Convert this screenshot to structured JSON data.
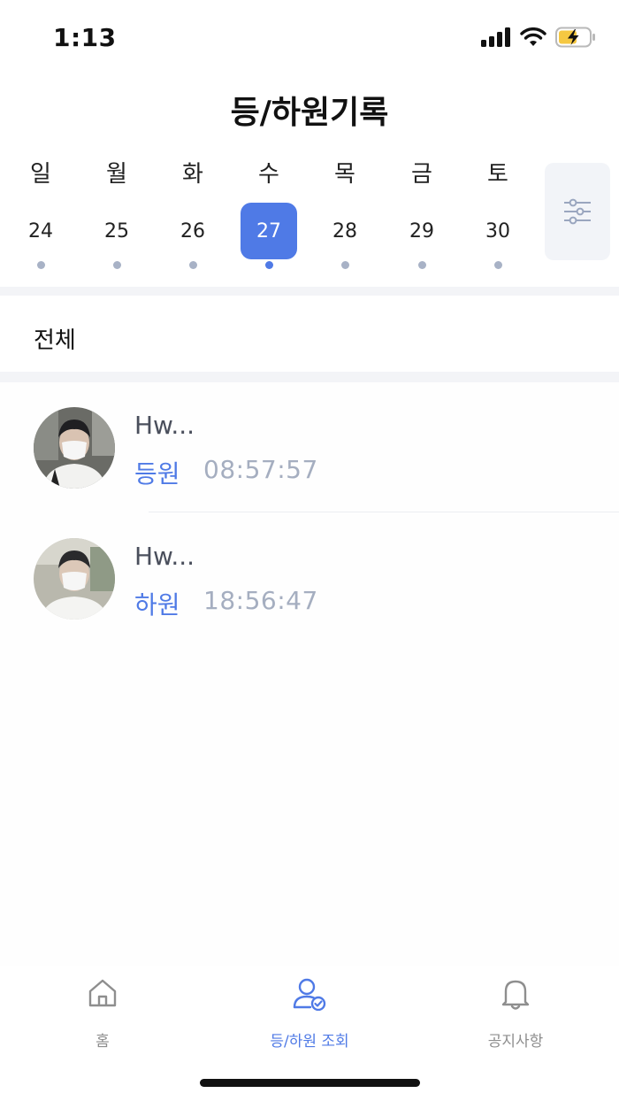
{
  "status_bar": {
    "time": "1:13"
  },
  "header": {
    "title": "등/하원기록"
  },
  "calendar": {
    "days": [
      {
        "weekday": "일",
        "date": "24",
        "selected": false
      },
      {
        "weekday": "월",
        "date": "25",
        "selected": false
      },
      {
        "weekday": "화",
        "date": "26",
        "selected": false
      },
      {
        "weekday": "수",
        "date": "27",
        "selected": true
      },
      {
        "weekday": "목",
        "date": "28",
        "selected": false
      },
      {
        "weekday": "금",
        "date": "29",
        "selected": false
      },
      {
        "weekday": "토",
        "date": "30",
        "selected": false
      }
    ],
    "filter_icon": "sliders-icon"
  },
  "filter": {
    "label": "전체"
  },
  "records": [
    {
      "name": "Hw...",
      "type": "등원",
      "time": "08:57:57"
    },
    {
      "name": "Hw...",
      "type": "하원",
      "time": "18:56:47"
    }
  ],
  "tabbar": {
    "tabs": [
      {
        "label": "홈",
        "icon": "home-icon",
        "active": false
      },
      {
        "label": "등/하원 조회",
        "icon": "user-check-icon",
        "active": true
      },
      {
        "label": "공지사항",
        "icon": "bell-icon",
        "active": false
      }
    ]
  },
  "colors": {
    "accent": "#4f7ae6",
    "muted_dot": "#a8b2c6",
    "time_text": "#a5aec0"
  }
}
